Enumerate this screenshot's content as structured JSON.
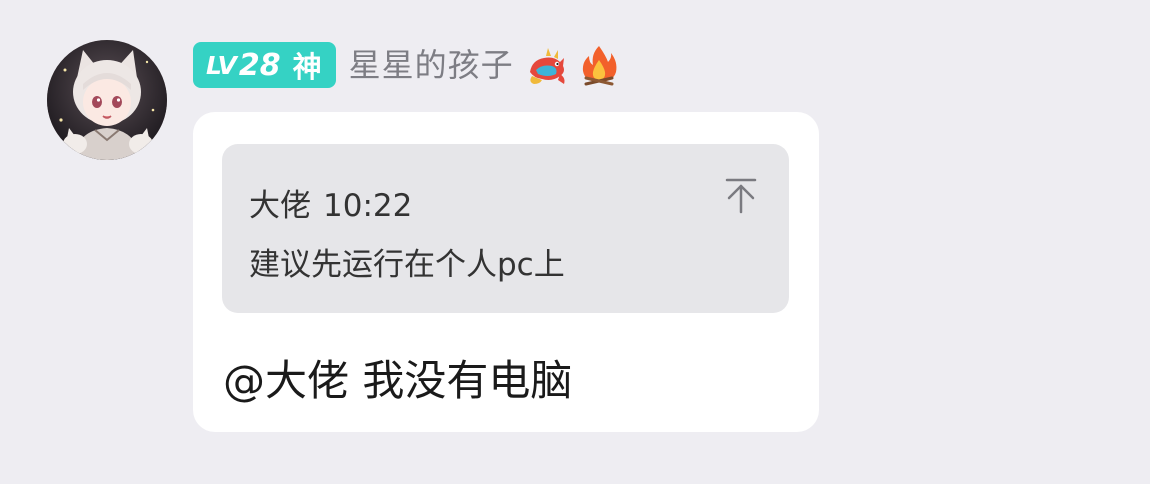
{
  "message": {
    "sender": {
      "avatar_icon": "anime-avatar",
      "level_label": "LV",
      "level_number": "28",
      "level_title": "神",
      "name": "星星的孩子",
      "badges": [
        "dragon-emoji",
        "fire-emoji"
      ]
    },
    "quote": {
      "author": "大佬",
      "time": "10:22",
      "text": "建议先运行在个人pc上",
      "jump_icon": "arrow-up-to-top-icon"
    },
    "body": "@大佬 我没有电脑"
  },
  "colors": {
    "background": "#eeedf2",
    "level_badge": "#35d2c4",
    "bubble": "#ffffff",
    "quote_bg": "#e6e6e9",
    "username": "#7d7d84"
  }
}
